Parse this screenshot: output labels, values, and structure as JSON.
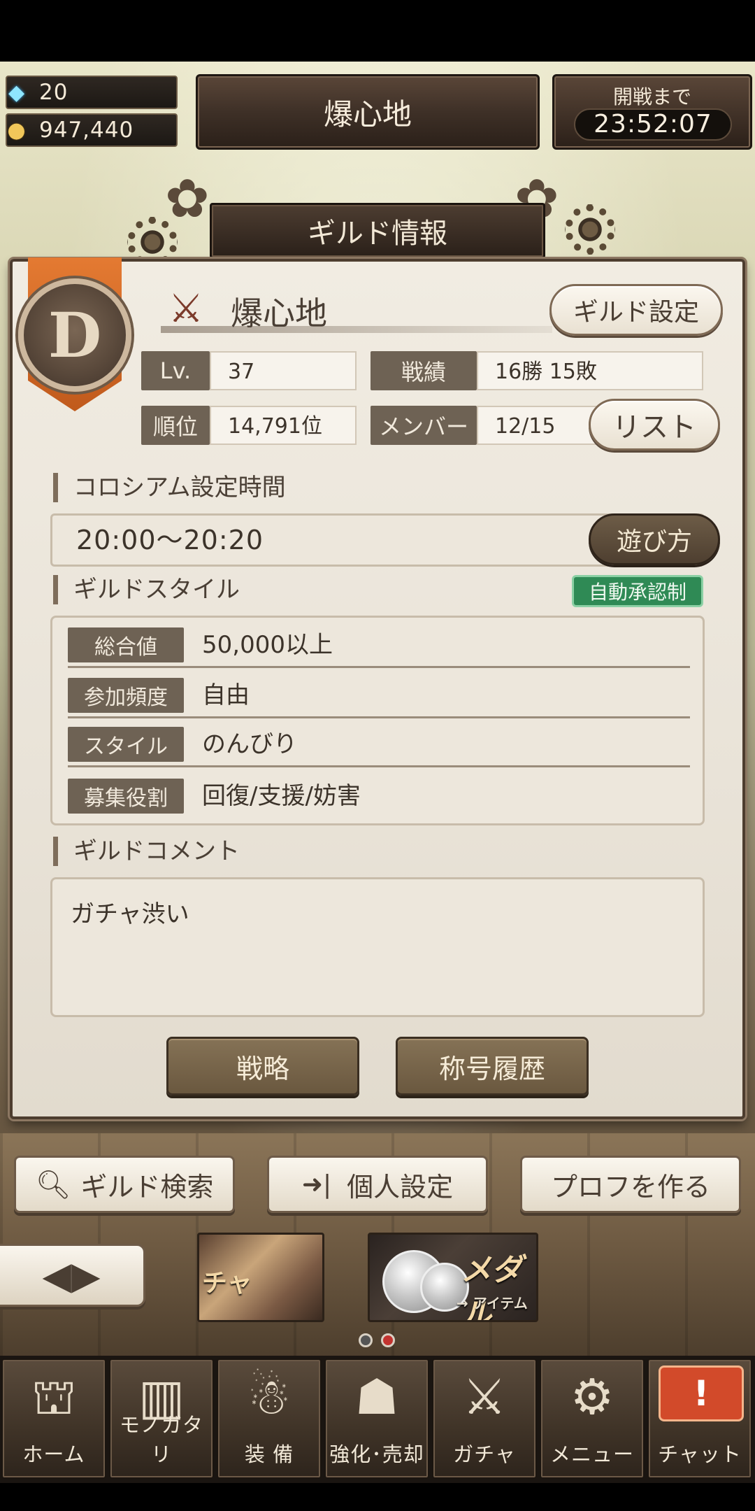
{
  "resources": {
    "crystals": "20",
    "coins": "947,440"
  },
  "header": {
    "guild_title": "爆心地",
    "timer_label": "開戦まで",
    "timer_value": "23:52:07"
  },
  "panel": {
    "title": "ギルド情報",
    "rank": "D",
    "guild_name": "爆心地",
    "settings_button": "ギルド設定",
    "stats": {
      "level_label": "Lv.",
      "level_value": "37",
      "record_label": "戦績",
      "record_value": "16勝 15敗",
      "rank_label": "順位",
      "rank_value": "14,791位",
      "members_label": "メンバー",
      "members_value": "12/15"
    },
    "list_button": "リスト",
    "coliseum": {
      "title": "コロシアム設定時間",
      "time": "20:00〜20:20",
      "how_to_play": "遊び方"
    },
    "style": {
      "title": "ギルドスタイル",
      "badge": "自動承認制",
      "rows": [
        {
          "label": "総合値",
          "value": "50,000以上"
        },
        {
          "label": "参加頻度",
          "value": "自由"
        },
        {
          "label": "スタイル",
          "value": "のんびり"
        },
        {
          "label": "募集役割",
          "value": "回復/支援/妨害"
        }
      ]
    },
    "comment": {
      "title": "ギルドコメント",
      "text": "ガチャ渋い"
    },
    "strategy_button": "戦略",
    "title_history_button": "称号履歴"
  },
  "actions": {
    "guild_search": "ギルド検索",
    "personal_settings": "個人設定",
    "create_profile": "プロフを作る"
  },
  "banners": {
    "gacha_text": "チャ",
    "medal_text": "メダル",
    "medal_sub": "→ アイテム"
  },
  "nav": {
    "items": [
      {
        "label": "ホーム",
        "icon": "castle-icon"
      },
      {
        "label": "モノガタリ",
        "icon": "book-icon"
      },
      {
        "label": "装 備",
        "icon": "puppet-icon"
      },
      {
        "label": "強化･売却",
        "icon": "mask-icon"
      },
      {
        "label": "ガチャ",
        "icon": "swords-icon"
      },
      {
        "label": "メニュー",
        "icon": "gears-icon"
      },
      {
        "label": "チャット",
        "icon": "chat-alert-icon"
      }
    ],
    "chat_alert": "!"
  }
}
